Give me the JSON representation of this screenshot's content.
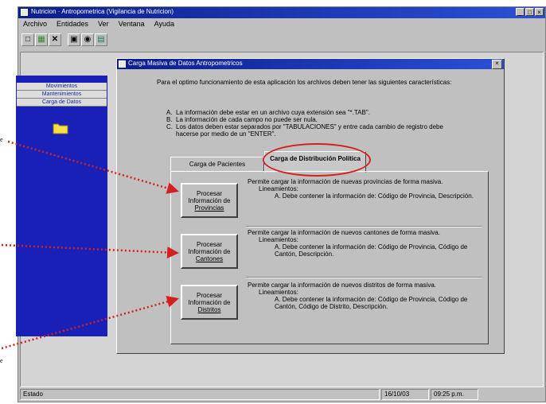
{
  "window": {
    "title": "Nutricion · Antropometrica (Vigilancia de Nutricion)"
  },
  "menu": [
    "Archivo",
    "Entidades",
    "Ver",
    "Ventana",
    "Ayuda"
  ],
  "toolbar_icons": [
    "new-icon",
    "copy-icon",
    "delete-icon",
    "save-icon",
    "find-icon",
    "print-icon"
  ],
  "sidebar": {
    "items": [
      "Movimientos",
      "Mantenimientos",
      "Carga de Datos"
    ]
  },
  "dialog": {
    "title": "Carga Masiva de Datos Antropometricos",
    "intro": "Para el optimo funcionamiento de esta aplicación los archivos deben tener las siguientes características:",
    "requirements": [
      {
        "k": "A.",
        "text": "La información debe estar en un archivo cuya extensión sea \"*.TAB\"."
      },
      {
        "k": "B.",
        "text": "La información de cada campo no puede ser nula."
      },
      {
        "k": "C.",
        "text": "Los datos deben estar separados por \"TABULACIONES\" y entre cada cambio de registro debe hacerse por medio de un \"ENTER\"."
      }
    ],
    "tabs": [
      "Carga de Pacientes",
      "Carga de Distribución Política"
    ],
    "processes": [
      {
        "button": [
          "Procesar",
          "Información de",
          "Provincias"
        ],
        "desc": "Permite cargar la información de nuevas provincias de forma masiva.",
        "heading": "Lineamientos:",
        "rule": "A. Debe contener la información de: Código de Provincia, Descripción."
      },
      {
        "button": [
          "Procesar",
          "Información de",
          "Cantones"
        ],
        "desc": "Permite cargar la información de nuevos cantones de forma masiva.",
        "heading": "Lineamientos:",
        "rule": "A. Debe contener la información de: Código de Provincia, Código de Cantón, Descripción."
      },
      {
        "button": [
          "Procesar",
          "Información de",
          "Distritos"
        ],
        "desc": "Permite cargar la información de nuevos distritos de forma masiva.",
        "heading": "Lineamientos:",
        "rule": "A. Debe contener la información de: Código de Provincia, Código de Cantón, Código de Distrito, Descripción."
      }
    ]
  },
  "status": {
    "state": "Estado",
    "date": "16/10/03",
    "time": "09:25 p.m."
  },
  "side_notes": [
    "e",
    "e"
  ],
  "colors": {
    "title": "#0a1e8c",
    "sidebar": "#1820b8",
    "highlight": "#d42020"
  }
}
